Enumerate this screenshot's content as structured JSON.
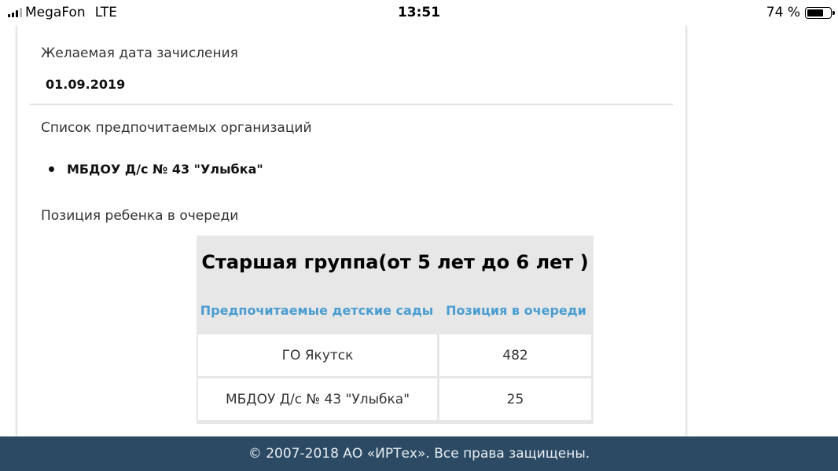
{
  "status_bar": {
    "carrier": "MegaFon",
    "network": "LTE",
    "time": "13:51",
    "battery_text": "74 %",
    "battery_level": 0.74,
    "signal_bars": 3,
    "signal_total": 4
  },
  "fields": {
    "enrollment_date_label": "Желаемая дата зачисления",
    "enrollment_date_value": "01.09.2019",
    "orgs_label": "Список предпочитаемых организаций",
    "orgs": [
      "МБДОУ Д/с № 43 \"Улыбка\""
    ],
    "queue_label": "Позиция ребенка в очереди"
  },
  "queue_table": {
    "title": "Старшая группа(от 5 лет до 6 лет )",
    "headers": [
      "Предпочитаемые детские сады",
      "Позиция в очереди"
    ],
    "rows": [
      [
        "ГО Якутск",
        "482"
      ],
      [
        "МБДОУ Д/с № 43 \"Улыбка\"",
        "25"
      ]
    ]
  },
  "footer": {
    "text": "© 2007-2018 АО «ИРТех». Все права защищены."
  },
  "colors": {
    "header_link": "#4a9dd1",
    "footer_bg": "#2c4a64",
    "table_bg": "#e7e7e7"
  }
}
